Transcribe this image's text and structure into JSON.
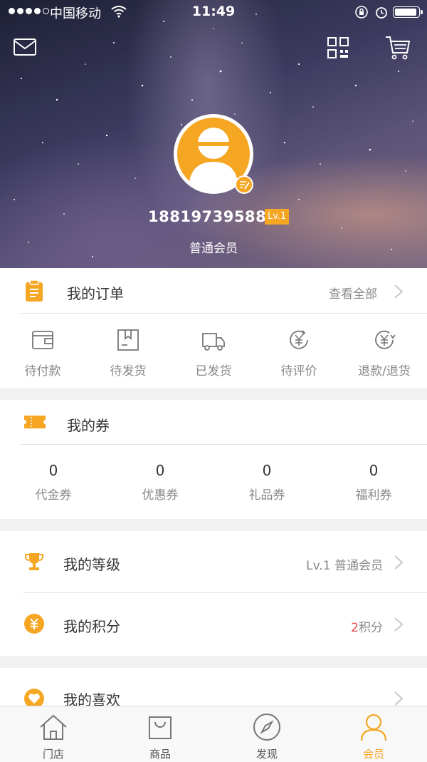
{
  "status_bar": {
    "carrier": "中国移动",
    "time": "11:49"
  },
  "profile": {
    "phone": "18819739588",
    "level_badge": "Lv.1",
    "member_type": "普通会员"
  },
  "orders": {
    "title": "我的订单",
    "view_all": "查看全部",
    "items": [
      {
        "label": "待付款",
        "icon": "wallet-icon"
      },
      {
        "label": "待发货",
        "icon": "package-icon"
      },
      {
        "label": "已发货",
        "icon": "truck-icon"
      },
      {
        "label": "待评价",
        "icon": "yuan-review-icon"
      },
      {
        "label": "退款/退货",
        "icon": "yuan-refund-icon"
      }
    ]
  },
  "coupons": {
    "title": "我的券",
    "items": [
      {
        "count": "0",
        "label": "代金券"
      },
      {
        "count": "0",
        "label": "优惠券"
      },
      {
        "count": "0",
        "label": "礼品券"
      },
      {
        "count": "0",
        "label": "福利券"
      }
    ]
  },
  "level": {
    "title": "我的等级",
    "value": "Lv.1 普通会员"
  },
  "points": {
    "title": "我的积分",
    "value_number": "2",
    "value_unit": "积分"
  },
  "favorites": {
    "title": "我的喜欢"
  },
  "tabbar": {
    "tabs": [
      {
        "label": "门店",
        "icon": "store-icon"
      },
      {
        "label": "商品",
        "icon": "shopping-bag-icon"
      },
      {
        "label": "发现",
        "icon": "compass-icon"
      },
      {
        "label": "会员",
        "icon": "user-icon"
      }
    ],
    "active": "会员"
  },
  "colors": {
    "accent": "#f5a623",
    "points_number": "#e94b4b"
  }
}
